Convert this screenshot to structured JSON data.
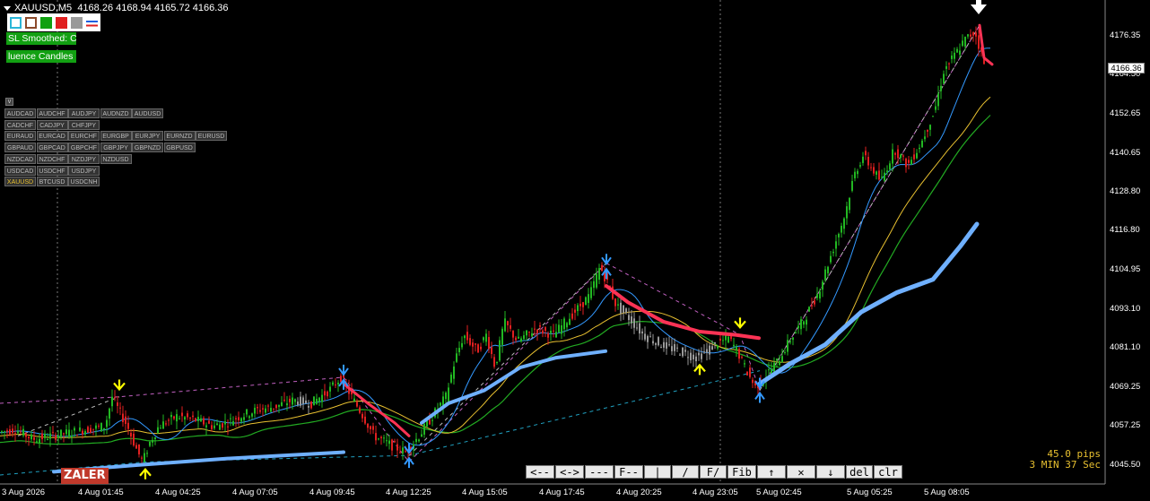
{
  "title": {
    "symbol": "XAUUSD,M5",
    "quote": "4168.26 4168.94 4165.72 4166.36"
  },
  "swatches": [
    {
      "name": "cyan-swatch",
      "color": "#2bb6d8"
    },
    {
      "name": "brown-swatch",
      "color": "#8b4a2b"
    },
    {
      "name": "green-swatch",
      "color": "#10a010"
    },
    {
      "name": "red-swatch",
      "color": "#e02020"
    },
    {
      "name": "gray-swatch",
      "color": "#999999"
    },
    {
      "name": "blue-red-swatch",
      "color": "#2060e0"
    }
  ],
  "indicator_labels": [
    "SL Smoothed: C",
    "luence Candles"
  ],
  "symbol_collapse": "v",
  "symbol_rows": [
    [
      "AUDCAD",
      "AUDCHF",
      "AUDJPY",
      "AUDNZD",
      "AUDUSD"
    ],
    [
      "CADCHF",
      "CADJPY",
      "CHFJPY"
    ],
    [
      "EURAUD",
      "EURCAD",
      "EURCHF",
      "EURGBP",
      "EURJPY",
      "EURNZD",
      "EURUSD"
    ],
    [
      "GBPAUD",
      "GBPCAD",
      "GBPCHF",
      "GBPJPY",
      "GBPNZD",
      "GBPUSD"
    ],
    [
      "NZDCAD",
      "NZDCHF",
      "NZDJPY",
      "NZDUSD"
    ],
    [
      "USDCAD",
      "USDCHF",
      "USDJPY"
    ],
    [
      "XAUUSD",
      "BTCUSD",
      "USDCNH"
    ]
  ],
  "active_symbol": "XAUUSD",
  "price_axis": [
    "4176.35",
    "4164.50",
    "4152.65",
    "4140.65",
    "4128.80",
    "4116.80",
    "4104.95",
    "4093.10",
    "4081.10",
    "4069.25",
    "4057.25",
    "4045.50"
  ],
  "current_price": "4166.36",
  "time_axis": [
    "3 Aug 2026",
    "4 Aug 01:45",
    "4 Aug 04:25",
    "4 Aug 07:05",
    "4 Aug 09:45",
    "4 Aug 12:25",
    "4 Aug 15:05",
    "4 Aug 17:45",
    "4 Aug 20:25",
    "4 Aug 23:05",
    "5 Aug 02:45",
    "5 Aug 05:25",
    "5 Aug 08:05"
  ],
  "toolbar": [
    "<--",
    "<->",
    "---",
    "F--",
    "|",
    "/",
    "F/",
    "Fib",
    "↑",
    "✕",
    "↓",
    "del",
    "clr"
  ],
  "info": {
    "pips": "45.0 pips",
    "timer": "3 MIN 37 Sec"
  },
  "watermark": "ZALER",
  "colors": {
    "bull": "#22b822",
    "bear": "#e02020",
    "neutral": "#999999",
    "signal": "#ffff00",
    "swing": "#3399ff",
    "zigzag": "#cc66cc"
  },
  "chart_data": {
    "type": "candlestick",
    "ylim": [
      4040,
      4183
    ],
    "path_points": [
      [
        0,
        4053
      ],
      [
        20,
        4054
      ],
      [
        40,
        4051
      ],
      [
        60,
        4052
      ],
      [
        80,
        4053
      ],
      [
        100,
        4054
      ],
      [
        120,
        4055
      ],
      [
        128,
        4064
      ],
      [
        135,
        4060
      ],
      [
        145,
        4055
      ],
      [
        155,
        4048
      ],
      [
        162,
        4044
      ],
      [
        170,
        4050
      ],
      [
        180,
        4055
      ],
      [
        200,
        4058
      ],
      [
        220,
        4057
      ],
      [
        240,
        4055
      ],
      [
        255,
        4056
      ],
      [
        270,
        4058
      ],
      [
        290,
        4060
      ],
      [
        310,
        4061
      ],
      [
        330,
        4063
      ],
      [
        350,
        4062
      ],
      [
        370,
        4066
      ],
      [
        383,
        4070
      ],
      [
        395,
        4064
      ],
      [
        410,
        4057
      ],
      [
        420,
        4052
      ],
      [
        440,
        4049
      ],
      [
        455,
        4047
      ],
      [
        470,
        4052
      ],
      [
        485,
        4058
      ],
      [
        500,
        4064
      ],
      [
        510,
        4075
      ],
      [
        520,
        4083
      ],
      [
        535,
        4078
      ],
      [
        545,
        4083
      ],
      [
        555,
        4073
      ],
      [
        565,
        4087
      ],
      [
        580,
        4081
      ],
      [
        600,
        4085
      ],
      [
        620,
        4083
      ],
      [
        640,
        4089
      ],
      [
        660,
        4095
      ],
      [
        672,
        4104
      ],
      [
        680,
        4099
      ],
      [
        690,
        4092
      ],
      [
        705,
        4088
      ],
      [
        720,
        4083
      ],
      [
        740,
        4080
      ],
      [
        760,
        4078
      ],
      [
        780,
        4076
      ],
      [
        800,
        4080
      ],
      [
        815,
        4082
      ],
      [
        825,
        4078
      ],
      [
        835,
        4072
      ],
      [
        845,
        4067
      ],
      [
        855,
        4070
      ],
      [
        870,
        4075
      ],
      [
        885,
        4082
      ],
      [
        900,
        4088
      ],
      [
        915,
        4096
      ],
      [
        930,
        4108
      ],
      [
        945,
        4120
      ],
      [
        955,
        4132
      ],
      [
        965,
        4138
      ],
      [
        985,
        4130
      ],
      [
        1000,
        4140
      ],
      [
        1015,
        4135
      ],
      [
        1030,
        4142
      ],
      [
        1045,
        4152
      ],
      [
        1055,
        4164
      ],
      [
        1070,
        4170
      ],
      [
        1080,
        4174
      ],
      [
        1090,
        4176
      ],
      [
        1100,
        4166
      ]
    ],
    "signals": [
      {
        "type": "buy",
        "label": "↓"
      },
      {
        "type": "sell",
        "label": "↑"
      }
    ]
  }
}
